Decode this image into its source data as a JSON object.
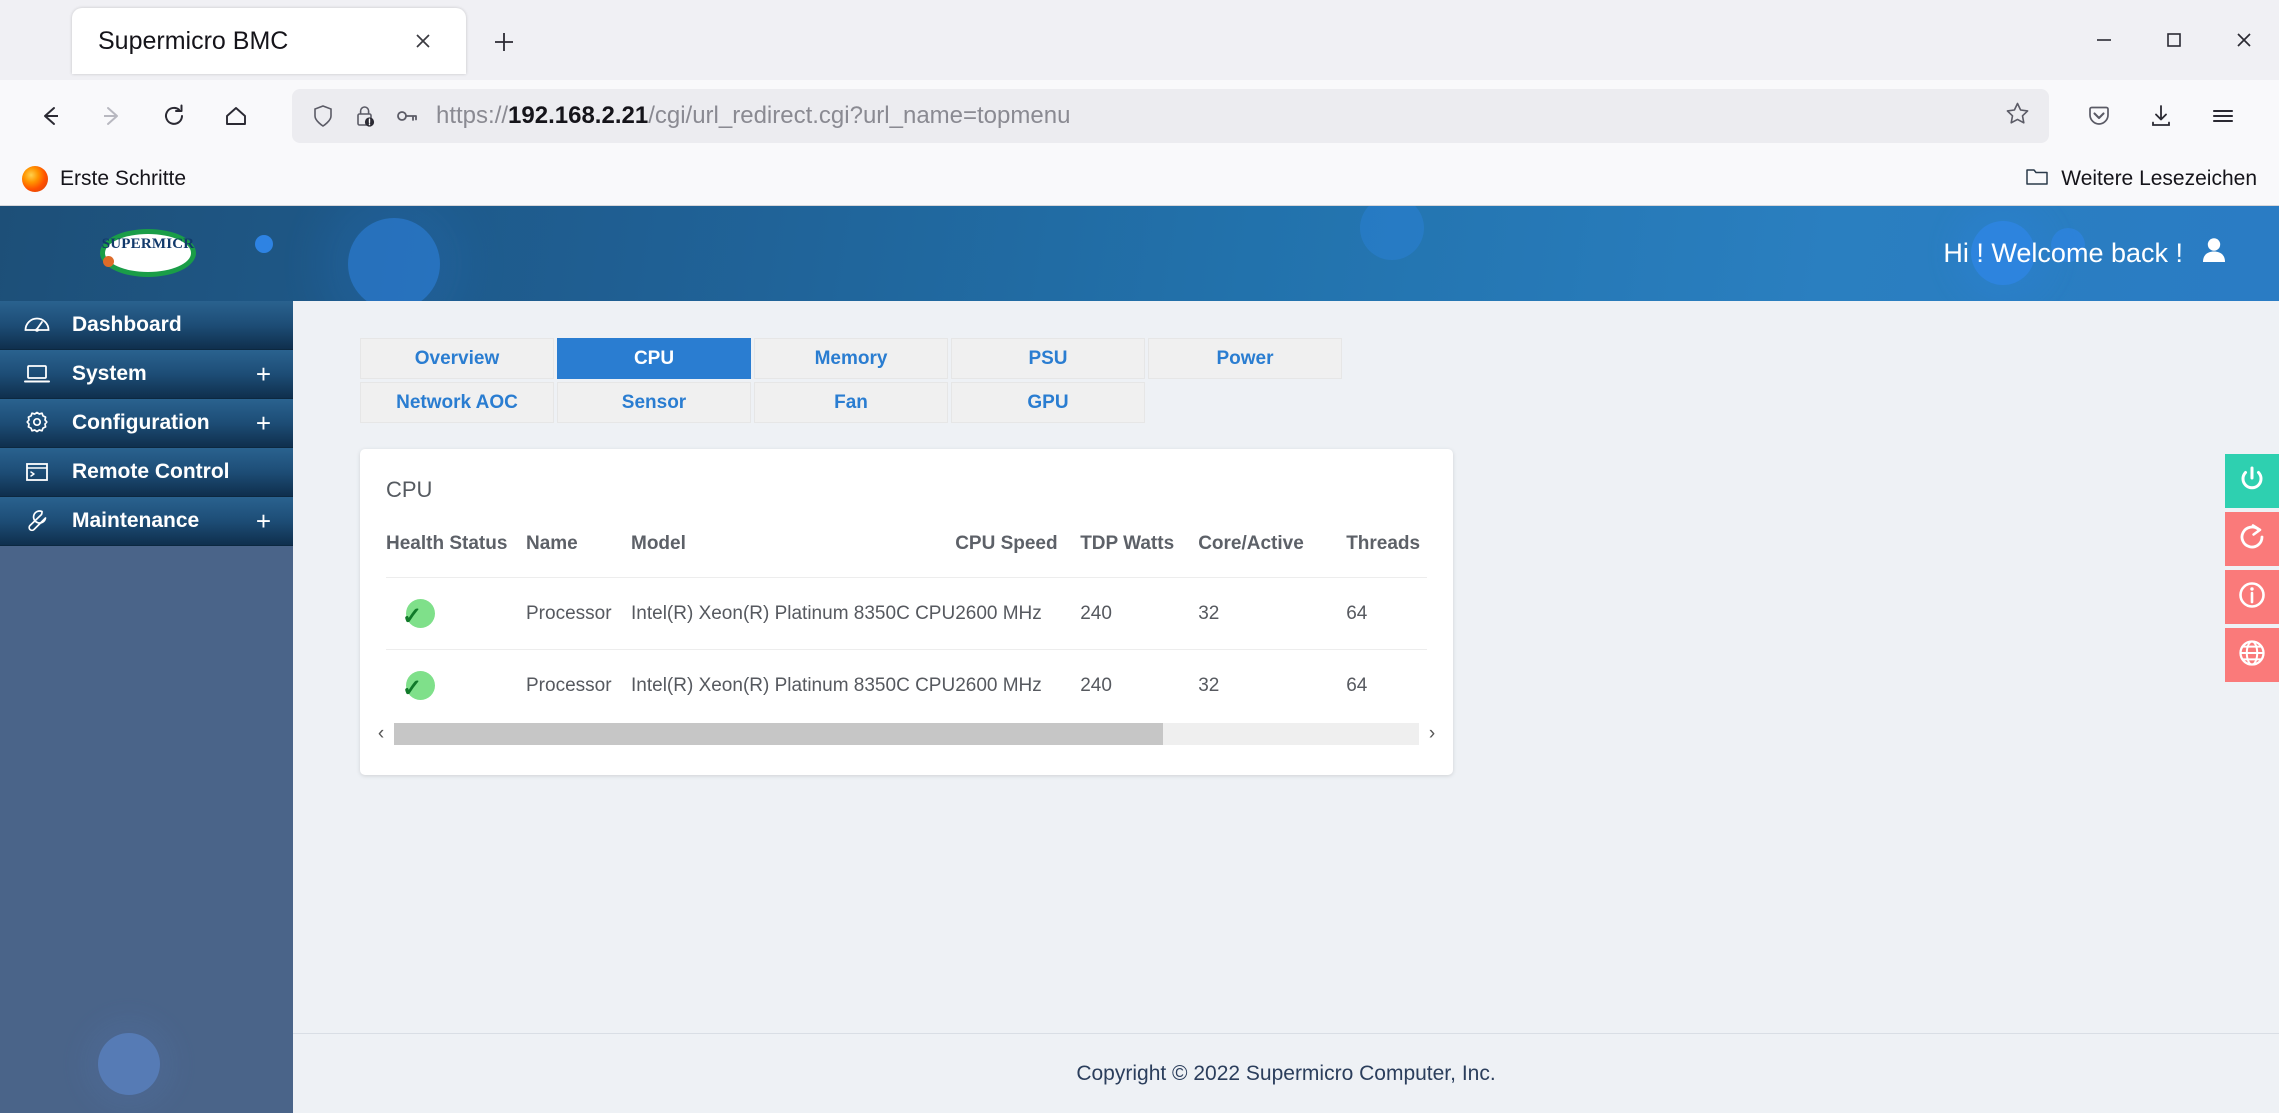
{
  "browser": {
    "tab": {
      "title": "Supermicro BMC",
      "close_label": "×"
    },
    "new_tab_label": "+",
    "window_controls": {
      "minimize": "minimize-icon",
      "maximize": "maximize-icon",
      "close": "close-icon"
    },
    "nav": {
      "back": "back-arrow-icon",
      "forward": "forward-arrow-icon",
      "reload": "reload-icon",
      "home": "home-icon",
      "shield": "shield-icon",
      "lock_warning": "lock-warning-icon",
      "permission_key": "key-icon",
      "bookmark_star": "star-icon",
      "pocket": "pocket-icon",
      "downloads": "download-icon",
      "app_menu": "hamburger-menu-icon"
    },
    "url": {
      "scheme": "https://",
      "host": "192.168.2.21",
      "path": "/cgi/url_redirect.cgi?url_name=topmenu"
    },
    "bookmarks": {
      "first_item": "Erste Schritte",
      "other_bookmarks": "Weitere Lesezeichen"
    }
  },
  "header": {
    "logo_text": "SUPERMICR",
    "welcome": "Hi ! Welcome back !",
    "avatar": "user-avatar-icon"
  },
  "sidebar": {
    "items": [
      {
        "label": "Dashboard",
        "icon": "gauge-icon",
        "expandable": false
      },
      {
        "label": "System",
        "icon": "laptop-icon",
        "expandable": true,
        "expand": "+"
      },
      {
        "label": "Configuration",
        "icon": "gear-icon",
        "expandable": true,
        "expand": "+"
      },
      {
        "label": "Remote Control",
        "icon": "terminal-icon",
        "expandable": false
      },
      {
        "label": "Maintenance",
        "icon": "wrench-icon",
        "expandable": true,
        "expand": "+"
      }
    ]
  },
  "tabs": {
    "row1": [
      {
        "label": "Overview",
        "active": false
      },
      {
        "label": "CPU",
        "active": true
      },
      {
        "label": "Memory",
        "active": false
      },
      {
        "label": "PSU",
        "active": false
      },
      {
        "label": "Power",
        "active": false
      }
    ],
    "row2": [
      {
        "label": "Network AOC",
        "active": false
      },
      {
        "label": "Sensor",
        "active": false
      },
      {
        "label": "Fan",
        "active": false
      },
      {
        "label": "GPU",
        "active": false
      }
    ]
  },
  "cpu_panel": {
    "title": "CPU",
    "columns": [
      "Health Status",
      "Name",
      "Model",
      "CPU Speed",
      "TDP Watts",
      "Core/Active",
      "Threads"
    ],
    "rows": [
      {
        "health": "ok",
        "name": "Processor",
        "model": "Intel(R) Xeon(R) Platinum 8350C CPU",
        "speed": "2600 MHz",
        "tdp": "240",
        "core_active": "32",
        "threads": "64"
      },
      {
        "health": "ok",
        "name": "Processor",
        "model": "Intel(R) Xeon(R) Platinum 8350C CPU",
        "speed": "2600 MHz",
        "tdp": "240",
        "core_active": "32",
        "threads": "64"
      }
    ],
    "scroll_left": "‹",
    "scroll_right": "›"
  },
  "action_rail": [
    {
      "name": "power-button",
      "icon": "power-icon",
      "color": "#2ed0b0"
    },
    {
      "name": "reset-button",
      "icon": "refresh-icon",
      "color": "#fa7a7a"
    },
    {
      "name": "info-button",
      "icon": "info-icon",
      "color": "#fa7a7a"
    },
    {
      "name": "network-button",
      "icon": "globe-icon",
      "color": "#fa7a7a"
    }
  ],
  "footer": {
    "copyright": "Copyright © 2022 Supermicro Computer, Inc."
  },
  "colors": {
    "accent_blue": "#2a7dd1",
    "health_green": "#7fe08a",
    "teal": "#2ed0b0",
    "red": "#fa7a7a"
  }
}
